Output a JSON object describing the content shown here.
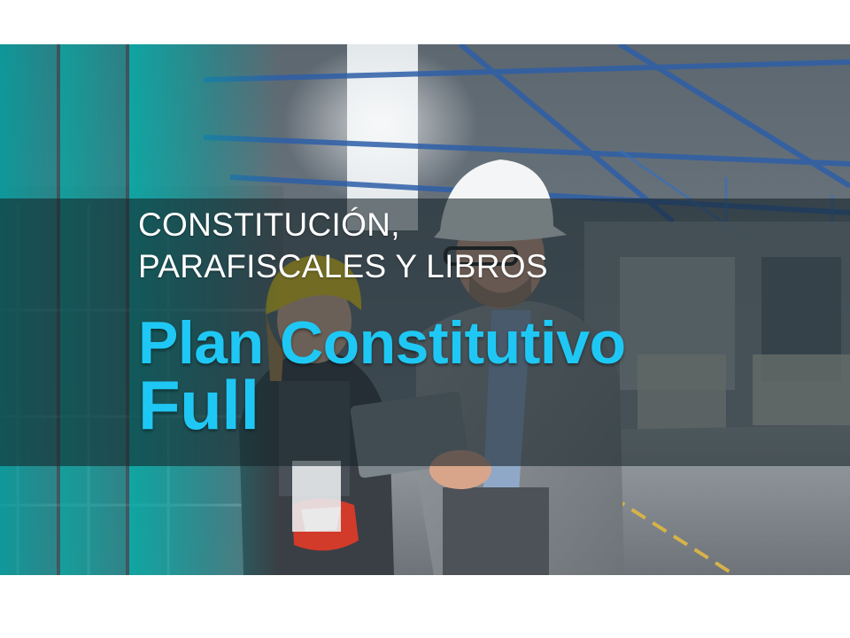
{
  "slide": {
    "subtitle_line1": "CONSTITUCIÓN,",
    "subtitle_line2": "PARAFISCALES  Y LIBROS",
    "title_line1": "Plan Constitutivo",
    "title_line2": "Full"
  },
  "colors": {
    "teal_band": "#00a5a5",
    "title_blue": "#1fc8f4",
    "subtitle_white": "#ffffff",
    "strip_dark": "#142328"
  },
  "photo": {
    "subject": "two workers in hard hats in an industrial warehouse"
  }
}
